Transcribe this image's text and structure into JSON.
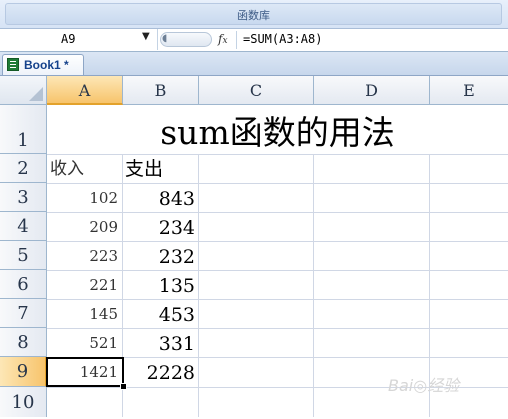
{
  "ribbon": {
    "group_label": "函数库"
  },
  "formula_bar": {
    "name_box": "A9",
    "fx_label": "fx",
    "formula": "=SUM(A3:A8)"
  },
  "workbook_tab": {
    "label": "Book1 *"
  },
  "columns": [
    "A",
    "B",
    "C",
    "D",
    "E"
  ],
  "rows": [
    "1",
    "2",
    "3",
    "4",
    "5",
    "6",
    "7",
    "8",
    "9",
    "10"
  ],
  "sheet": {
    "title": "sum函数的用法",
    "header_a": "收入",
    "header_b": "支出",
    "data": [
      {
        "a": "102",
        "b": "843"
      },
      {
        "a": "209",
        "b": "234"
      },
      {
        "a": "223",
        "b": "232"
      },
      {
        "a": "221",
        "b": "135"
      },
      {
        "a": "145",
        "b": "453"
      },
      {
        "a": "521",
        "b": "331"
      },
      {
        "a": "1421",
        "b": "2228"
      }
    ]
  },
  "watermark": "Bai◎经验",
  "colors": {
    "selection_header": "#f7c46c",
    "grid_line": "#d0d7e5",
    "header_border": "#9eb6ce"
  }
}
